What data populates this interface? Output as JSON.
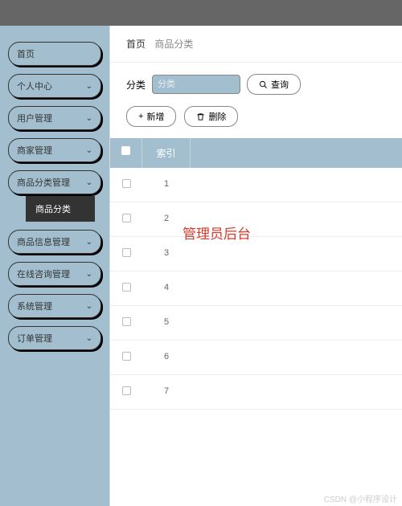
{
  "breadcrumb": {
    "home": "首页",
    "current": "商品分类"
  },
  "sidebar": {
    "items": [
      {
        "label": "首页"
      },
      {
        "label": "个人中心"
      },
      {
        "label": "用户管理"
      },
      {
        "label": "商家管理"
      },
      {
        "label": "商品分类管理"
      },
      {
        "label": "商品信息管理"
      },
      {
        "label": "在线咨询管理"
      },
      {
        "label": "系统管理"
      },
      {
        "label": "订单管理"
      }
    ],
    "subItem": "商品分类"
  },
  "filter": {
    "label": "分类",
    "placeholder": "分类",
    "searchBtn": "查询"
  },
  "actions": {
    "add": "新增",
    "delete": "删除"
  },
  "table": {
    "header": {
      "index": "索引"
    },
    "rows": [
      {
        "idx": "1"
      },
      {
        "idx": "2"
      },
      {
        "idx": "3"
      },
      {
        "idx": "4"
      },
      {
        "idx": "5"
      },
      {
        "idx": "6"
      },
      {
        "idx": "7"
      }
    ]
  },
  "overlay": "管理员后台",
  "watermark": "CSDN @小程序设计"
}
